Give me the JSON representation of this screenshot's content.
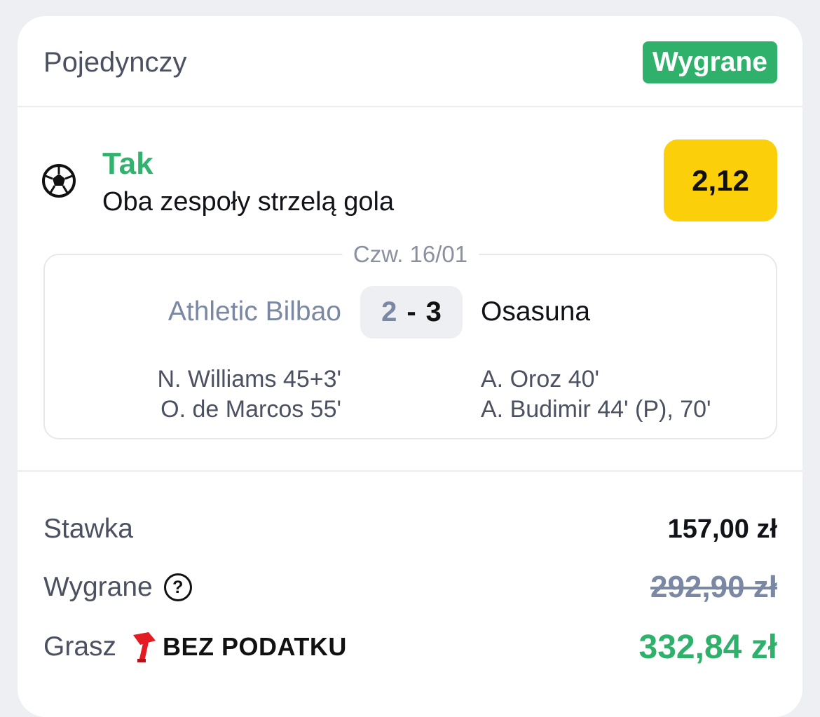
{
  "header": {
    "bet_type": "Pojedynczy",
    "status": "Wygrane",
    "status_color": "#2fb16b"
  },
  "selection": {
    "sport_icon": "soccer-ball-icon",
    "pick": "Tak",
    "market": "Oba zespoły strzelą gola",
    "odds": "2,12",
    "odds_color": "#fbd00b"
  },
  "match": {
    "date": "Czw. 16/01",
    "home_team": "Athletic Bilbao",
    "away_team": "Osasuna",
    "home_score": "2",
    "separator": "-",
    "away_score": "3",
    "home_scorers": [
      "N. Williams 45+3'",
      "O. de Marcos 55'"
    ],
    "away_scorers": [
      "A. Oroz 40'",
      "A. Budimir 44' (P), 70'"
    ]
  },
  "summary": {
    "stake_label": "Stawka",
    "stake_value": "157,00 zł",
    "winnings_label": "Wygrane",
    "winnings_value": "292,90 zł",
    "help_icon": "question-circle-icon",
    "play_label": "Grasz",
    "tax_free_icon": "hammer-icon",
    "tax_free_text": "BEZ PODATKU",
    "net_value": "332,84 zł"
  }
}
